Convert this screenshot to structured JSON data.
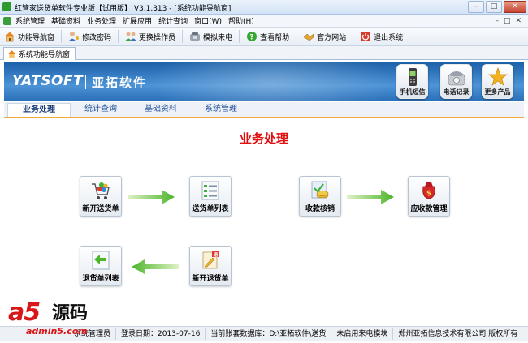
{
  "window": {
    "title": "红管家送货单软件专业版【试用版】 V3.1.313 - [系统功能导航窗]",
    "buttons": {
      "minimize": "–",
      "maximize": "□",
      "close": "✕"
    }
  },
  "menubar": {
    "items": [
      "系统管理",
      "基础资料",
      "业务处理",
      "扩展应用",
      "统计查询",
      "窗口(W)",
      "帮助(H)"
    ],
    "child_buttons": [
      "–",
      "□",
      "✕"
    ]
  },
  "toolbar": {
    "items": [
      {
        "label": "功能导航窗",
        "icon": "home-icon"
      },
      {
        "label": "修改密码",
        "icon": "user-key-icon"
      },
      {
        "label": "更换操作员",
        "icon": "users-icon"
      },
      {
        "label": "模拟来电",
        "icon": "phone-icon"
      },
      {
        "label": "查看帮助",
        "icon": "help-icon"
      },
      {
        "label": "官方网站",
        "icon": "handshake-icon"
      },
      {
        "label": "退出系统",
        "icon": "power-icon"
      }
    ]
  },
  "doc_tab": {
    "label": "系统功能导航窗"
  },
  "banner": {
    "logo_latin": "YATSOFT",
    "logo_cn": "亚拓软件",
    "quick": [
      {
        "label": "手机短信",
        "icon": "mobile-phone-icon"
      },
      {
        "label": "电话记录",
        "icon": "telephone-icon"
      },
      {
        "label": "更多产品",
        "icon": "star-icon"
      }
    ]
  },
  "module_tabs": [
    "业务处理",
    "统计查询",
    "基础资料",
    "系统管理"
  ],
  "section": {
    "title": "业务处理",
    "buttons": {
      "new_delivery": "新开送货单",
      "delivery_list": "送货单列表",
      "receipt_writeoff": "收款核销",
      "receivables": "应收款管理",
      "return_list": "退货单列表",
      "new_return": "新开退货单"
    }
  },
  "statusbar": {
    "operator": "系统管理员",
    "login_date": "登录日期：2013-07-16",
    "database": "当前账套数据库：D:\\亚拓软件\\送货",
    "caller_module": "未启用来电模块",
    "copyright": "郑州亚拓信息技术有限公司 版权所有"
  },
  "watermark": {
    "brand": "a5",
    "brand_cn": "源码",
    "url": "admin5.com"
  },
  "colors": {
    "accent": "#e01010",
    "banner": "#2a6fb8",
    "tab_underline": "#f2a93b"
  }
}
